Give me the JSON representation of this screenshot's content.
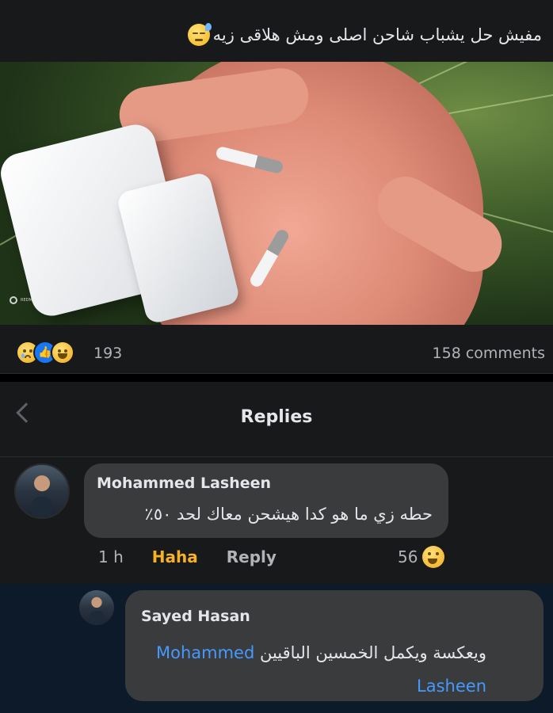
{
  "post": {
    "caption": "مفيش حل يشباب شاحن اصلى ومش هلاقى زيه",
    "caption_emoji": "sweat-smile-emoji",
    "photo_watermark": "REDMI NOTE 8"
  },
  "reactions": {
    "icons": [
      "sad-reaction-icon",
      "like-reaction-icon",
      "haha-reaction-icon"
    ],
    "count": "193",
    "comments_label": "158 comments"
  },
  "replies": {
    "title": "Replies"
  },
  "comment": {
    "author": "Mohammed Lasheen",
    "text": "حطه زي ما هو كدا هيشحن معاك لحد ٥٠٪",
    "time": "1 h",
    "haha_label": "Haha",
    "reply_label": "Reply",
    "reaction_count": "56"
  },
  "reply": {
    "author": "Sayed Hasan",
    "mention": "Mohammed Lasheen",
    "text": "ويعكسة ويكمل الخمسين الباقيين"
  },
  "colors": {
    "background": "#18191a",
    "bubble": "#3a3b3c",
    "haha": "#f7b125",
    "mention": "#4599ff",
    "like": "#1877f2"
  }
}
